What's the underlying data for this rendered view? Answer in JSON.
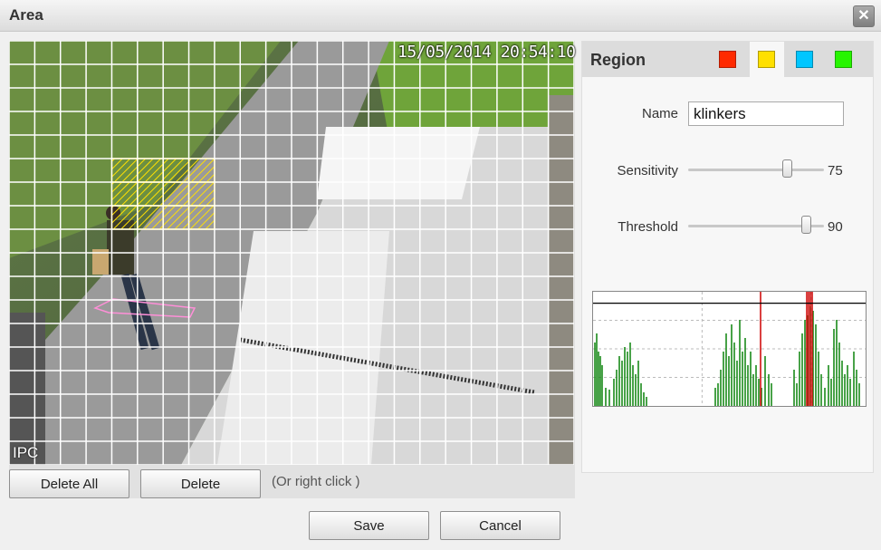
{
  "window": {
    "title": "Area",
    "close_label": "✕"
  },
  "video": {
    "timestamp": "15/05/2014 20:54:10",
    "channel_label": "IPC",
    "selected_cells": [
      [
        5,
        13
      ],
      [
        5,
        14
      ],
      [
        5,
        15
      ],
      [
        5,
        16
      ],
      [
        6,
        13
      ],
      [
        6,
        14
      ],
      [
        6,
        15
      ],
      [
        6,
        16
      ],
      [
        7,
        13
      ],
      [
        7,
        14
      ],
      [
        7,
        15
      ],
      [
        7,
        16
      ]
    ]
  },
  "buttons": {
    "delete_all": "Delete All",
    "delete": "Delete",
    "hint": "(Or right click )",
    "save": "Save",
    "cancel": "Cancel"
  },
  "region": {
    "title": "Region",
    "colors": [
      "#ff2a00",
      "#ffe000",
      "#00c6ff",
      "#27f500"
    ],
    "active_color_index": 1,
    "name_label": "Name",
    "name_value": "klinkers",
    "sensitivity_label": "Sensitivity",
    "sensitivity_value": "75",
    "sensitivity_level": 75,
    "threshold_label": "Threshold",
    "threshold_value": "90",
    "threshold_level": 90
  },
  "graph": {
    "threshold_level": 90,
    "bars": [
      0,
      0,
      55,
      65,
      45,
      40,
      0,
      0,
      0,
      0,
      0,
      0,
      0,
      0,
      20,
      0,
      0,
      18,
      0,
      35,
      0,
      40,
      0,
      50,
      0,
      45,
      0,
      60,
      0,
      45,
      0,
      20,
      0,
      15,
      0,
      0,
      0,
      0,
      0,
      0,
      0,
      0,
      0,
      0,
      0,
      0,
      0,
      0,
      0,
      0,
      0,
      0,
      0,
      0,
      0,
      0,
      0,
      0,
      0,
      0,
      0,
      0,
      0,
      0,
      0,
      0,
      0,
      0,
      0,
      0,
      0,
      0,
      0,
      0,
      0,
      0,
      0,
      0,
      0,
      0,
      0,
      0,
      0,
      0,
      0,
      0,
      0,
      0,
      0,
      0,
      0,
      0,
      0,
      0,
      0,
      0,
      0,
      0,
      0,
      0,
      0,
      0,
      0,
      0,
      0,
      0,
      0,
      0,
      0,
      0,
      0,
      0,
      0,
      0,
      0,
      0,
      0,
      0,
      0,
      0,
      0,
      0,
      0,
      0,
      0,
      0,
      0,
      0,
      0,
      0,
      0,
      0,
      0,
      0,
      0,
      0,
      0,
      0,
      0,
      0,
      0,
      0,
      0,
      0,
      0,
      0,
      0,
      0,
      0,
      0,
      0,
      0,
      0,
      0,
      0,
      0,
      0,
      0,
      0,
      0,
      0,
      0,
      0,
      0,
      0,
      0,
      0,
      0,
      0,
      0,
      0,
      0,
      0,
      0,
      0,
      0,
      0,
      0,
      0,
      0,
      0,
      0,
      0,
      0,
      0,
      0,
      0,
      0,
      0,
      0,
      0,
      0,
      0,
      0,
      0,
      0,
      0,
      0,
      0,
      0,
      0,
      0,
      0,
      0,
      0,
      0,
      0,
      0,
      0,
      0,
      0,
      0,
      0,
      0,
      0,
      0,
      0,
      0,
      0,
      0,
      0,
      0,
      0,
      0,
      0,
      0,
      0,
      0,
      0,
      0,
      0,
      0,
      0,
      0,
      0,
      0,
      0,
      0,
      0,
      0,
      0,
      0,
      0,
      0,
      0,
      0,
      0,
      0,
      0,
      0,
      0,
      0,
      0,
      0,
      0,
      0,
      0,
      0,
      0,
      0,
      0,
      0,
      0,
      0,
      0,
      0,
      0,
      0,
      0,
      0,
      0,
      0,
      0,
      0,
      0,
      0,
      0,
      0,
      0,
      0,
      0,
      0,
      0,
      0,
      0,
      0,
      0,
      0,
      0,
      0,
      0,
      0,
      0,
      0,
      0,
      0,
      0,
      0,
      0,
      0,
      0,
      0,
      0,
      0,
      0,
      0,
      0,
      0,
      0,
      0,
      0,
      0,
      0,
      0,
      0,
      0,
      0,
      0,
      0,
      0,
      0,
      0,
      0,
      0
    ]
  }
}
